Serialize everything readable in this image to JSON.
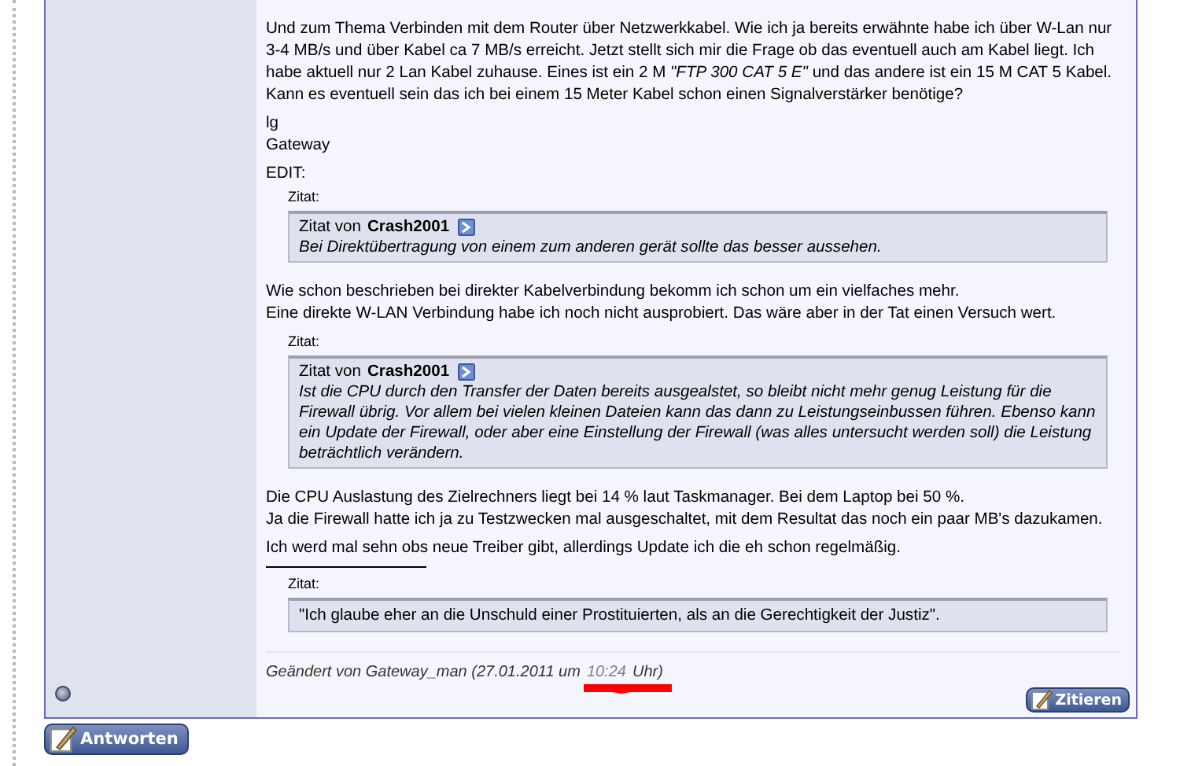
{
  "post": {
    "blocks": [
      {
        "kind": "text",
        "lines": [
          "Und zum Thema Verbinden mit dem Router über Netzwerkkabel. Wie ich ja bereits erwähnte habe ich über W-Lan nur 3-4 MB/s und über Kabel ca 7 MB/s erreicht. Jetzt stellt sich mir die Frage ob das eventuell auch am Kabel liegt. Ich habe aktuell nur 2 Lan Kabel zuhause. Eines ist ein 2 M *\"FTP 300 CAT 5 E\"* und das andere ist ein 15 M CAT 5 Kabel. Kann es eventuell sein das ich bei einem 15 Meter Kabel schon einen Signalverstärker benötige?"
        ]
      },
      {
        "kind": "text",
        "lines": [
          "lg",
          "Gateway"
        ]
      },
      {
        "kind": "text",
        "lines": [
          "EDIT:"
        ]
      },
      {
        "kind": "quote",
        "label": "Zitat:",
        "author_prefix": "Zitat von",
        "author": "Crash2001",
        "text": "Bei Direktübertragung von einem zum anderen gerät sollte das besser aussehen."
      },
      {
        "kind": "text",
        "lines": [
          "Wie schon beschrieben bei direkter Kabelverbindung bekomm ich schon um ein vielfaches mehr.",
          "Eine direkte W-LAN Verbindung habe ich noch nicht ausprobiert. Das wäre aber in der Tat einen Versuch wert."
        ]
      },
      {
        "kind": "quote",
        "label": "Zitat:",
        "author_prefix": "Zitat von",
        "author": "Crash2001",
        "text": "Ist die CPU durch den Transfer der Daten bereits ausgealstet, so bleibt nicht mehr genug Leistung für die Firewall übrig. Vor allem bei vielen kleinen Dateien kann das dann zu Leistungseinbussen führen. Ebenso kann ein Update der Firewall, oder aber eine Einstellung der Firewall (was alles untersucht werden soll) die Leistung beträchtlich verändern."
      },
      {
        "kind": "text",
        "lines": [
          "Die CPU Auslastung des Zielrechners liegt bei 14 % laut Taskmanager. Bei dem Laptop bei 50 %.",
          "Ja die Firewall hatte ich ja zu Testzwecken mal ausgeschaltet, mit dem Resultat das noch ein paar MB's dazukamen."
        ]
      },
      {
        "kind": "text",
        "lines": [
          "Ich werd mal sehn obs neue Treiber gibt, allerdings Update ich die eh schon regelmäßig."
        ]
      }
    ],
    "signature": {
      "label": "Zitat:",
      "text": "\"Ich glaube eher an die Unschuld einer Prostituierten, als an die Gerechtigkeit der Justiz\"."
    },
    "edited": {
      "prefix": "Geändert von Gateway_man (27.01.2011 um",
      "time": "10:24",
      "suffix": "Uhr)"
    },
    "quote_button": "Zitieren"
  },
  "reply_button": "Antworten"
}
